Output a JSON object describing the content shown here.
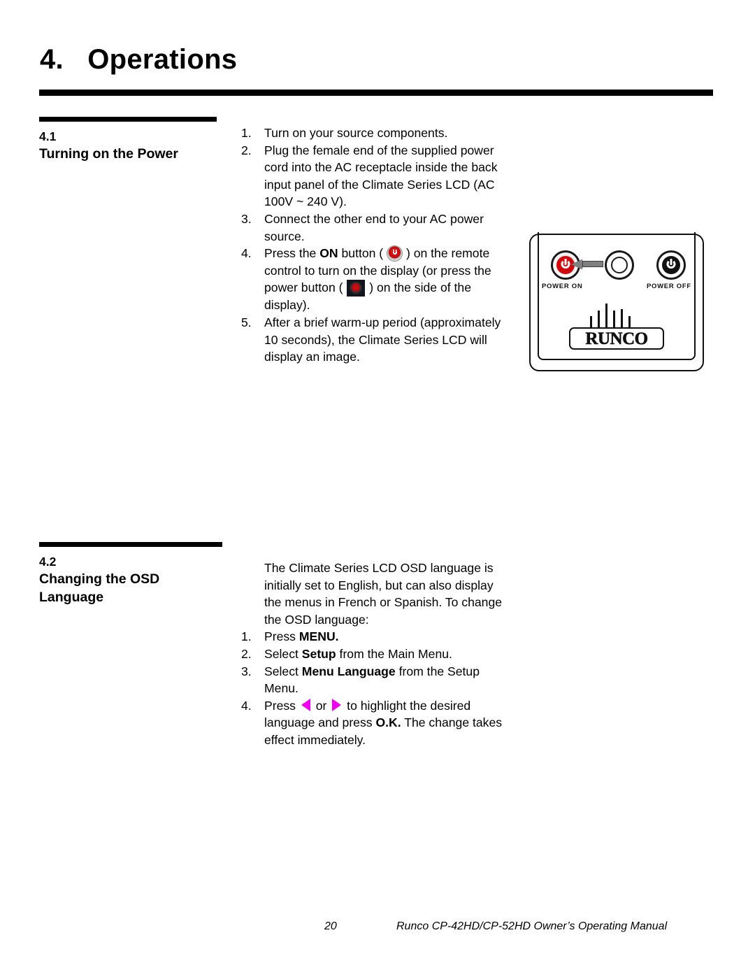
{
  "page": {
    "chapter_number": "4.",
    "chapter_title": "Operations",
    "chapter_heading": "4.   Operations"
  },
  "sections": {
    "s41": {
      "number": "4.1",
      "title": "Turning on the Power",
      "steps": [
        {
          "num": "1.",
          "text": "Turn on your source components."
        },
        {
          "num": "2.",
          "text": "Plug the female end of the supplied power cord into the AC receptacle inside the back input panel of the Climate Series LCD (AC 100V ~ 240 V)."
        },
        {
          "num": "3.",
          "text": "Connect the other end to your AC power source."
        },
        {
          "num": "4.",
          "part1": "Press the ",
          "bold1": "ON",
          "part2": " button ( ",
          "icon1": "power-on-round-icon",
          "part3": " ) on the remote control to turn on the display (or press the power button ( ",
          "icon2": "power-square-icon",
          "part4": " ) on the side of the display)."
        },
        {
          "num": "5.",
          "text": "After a brief warm-up period (approximately 10 seconds), the Climate Series LCD will display an image."
        }
      ]
    },
    "s42": {
      "number": "4.2",
      "title": "Changing the OSD Language",
      "paragraph": "The Climate Series LCD OSD language is initially set to English, but can also display the menus in French or Spanish. To change the OSD language:",
      "steps": [
        {
          "num": "1.",
          "part1": "Press ",
          "bold1": "MENU.",
          "part2": ""
        },
        {
          "num": "2.",
          "part1": "Select ",
          "bold1": "Setup",
          "part2": " from the Main Menu."
        },
        {
          "num": "3.",
          "part1": "Select ",
          "bold1": "Menu Language",
          "part2": " from the Setup Menu."
        },
        {
          "num": "4.",
          "part1": "Press ",
          "icon1": "arrow-left-icon",
          "part2": " or ",
          "icon2": "arrow-right-icon",
          "part3": " to highlight the desired language and press ",
          "bold1": "O.K.",
          "part4": " The change takes effect immediately."
        }
      ]
    }
  },
  "illustration": {
    "name": "remote-control-power-buttons",
    "label_power_on": "POWER ON",
    "label_power_off": "POWER OFF",
    "brand": "RUNCO"
  },
  "footer": {
    "page_number": "20",
    "manual_title": "Runco CP-42HD/CP-52HD Owner’s Operating Manual"
  },
  "colors": {
    "accent_magenta": "#F000F0",
    "power_red": "#D0080C",
    "ink": "#000000",
    "paper": "#FFFFFF",
    "arrow_gray": "#808080"
  }
}
